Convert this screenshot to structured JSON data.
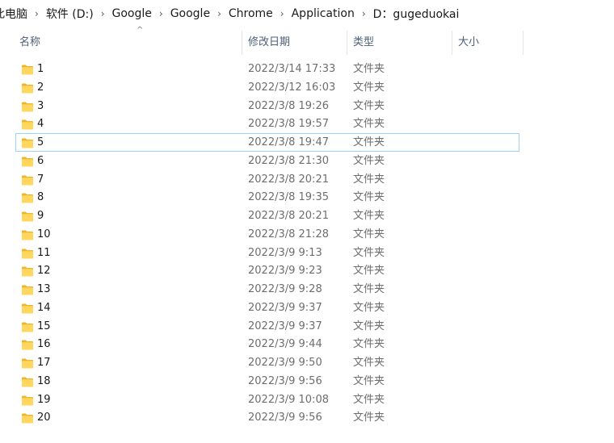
{
  "breadcrumb": {
    "items": [
      "此电脑",
      "软件 (D:)",
      "Google",
      "Google",
      "Chrome",
      "Application",
      "D：gugeduokai"
    ],
    "separator": "›"
  },
  "columns": {
    "name": "名称",
    "date": "修改日期",
    "type": "类型",
    "size": "大小",
    "sort_indicator": "^"
  },
  "focused_index": 4,
  "rows": [
    {
      "name": "1",
      "date": "2022/3/14 17:33",
      "type": "文件夹"
    },
    {
      "name": "2",
      "date": "2022/3/12 16:03",
      "type": "文件夹"
    },
    {
      "name": "3",
      "date": "2022/3/8 19:26",
      "type": "文件夹"
    },
    {
      "name": "4",
      "date": "2022/3/8 19:57",
      "type": "文件夹"
    },
    {
      "name": "5",
      "date": "2022/3/8 19:47",
      "type": "文件夹"
    },
    {
      "name": "6",
      "date": "2022/3/8 21:30",
      "type": "文件夹"
    },
    {
      "name": "7",
      "date": "2022/3/8 20:21",
      "type": "文件夹"
    },
    {
      "name": "8",
      "date": "2022/3/8 19:35",
      "type": "文件夹"
    },
    {
      "name": "9",
      "date": "2022/3/8 20:21",
      "type": "文件夹"
    },
    {
      "name": "10",
      "date": "2022/3/8 21:28",
      "type": "文件夹"
    },
    {
      "name": "11",
      "date": "2022/3/9 9:13",
      "type": "文件夹"
    },
    {
      "name": "12",
      "date": "2022/3/9 9:23",
      "type": "文件夹"
    },
    {
      "name": "13",
      "date": "2022/3/9 9:28",
      "type": "文件夹"
    },
    {
      "name": "14",
      "date": "2022/3/9 9:37",
      "type": "文件夹"
    },
    {
      "name": "15",
      "date": "2022/3/9 9:37",
      "type": "文件夹"
    },
    {
      "name": "16",
      "date": "2022/3/9 9:44",
      "type": "文件夹"
    },
    {
      "name": "17",
      "date": "2022/3/9 9:50",
      "type": "文件夹"
    },
    {
      "name": "18",
      "date": "2022/3/9 9:56",
      "type": "文件夹"
    },
    {
      "name": "19",
      "date": "2022/3/9 10:08",
      "type": "文件夹"
    },
    {
      "name": "20",
      "date": "2022/3/9 9:56",
      "type": "文件夹"
    }
  ],
  "colors": {
    "focus_border": "#99d1ff",
    "folder_body": "#ffd75e",
    "folder_tab": "#f0b429"
  },
  "icons": {
    "folder": "folder-icon",
    "separator": "chevron-right-icon"
  }
}
